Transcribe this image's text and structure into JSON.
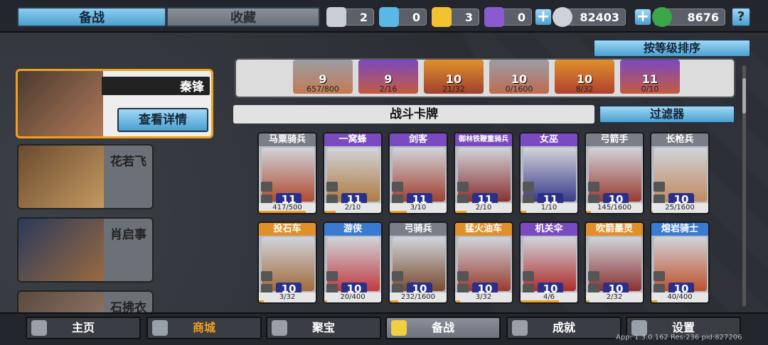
{
  "tabs": {
    "active": "备战",
    "inactive": "收藏"
  },
  "resources": [
    {
      "icon": "silver-chest-icon",
      "value": "2",
      "color": "#c8cdd6"
    },
    {
      "icon": "crystal-chest-icon",
      "value": "0",
      "color": "#59b8e6"
    },
    {
      "icon": "gold-chest-icon",
      "value": "3",
      "color": "#f2c230"
    },
    {
      "icon": "purple-chest-icon",
      "value": "0",
      "color": "#8a5ad0"
    }
  ],
  "coins": "82403",
  "gems": "8676",
  "sort_label": "按等级排序",
  "leaders": [
    {
      "name": "秦锋",
      "detail": "查看详情"
    },
    {
      "name": "花若飞"
    },
    {
      "name": "肖启事"
    },
    {
      "name": "石拂衣"
    }
  ],
  "deck": [
    {
      "level": "9",
      "count": "657/800"
    },
    {
      "level": "9",
      "count": "2/16"
    },
    {
      "level": "10",
      "count": "21/32"
    },
    {
      "level": "10",
      "count": "0/1600"
    },
    {
      "level": "10",
      "count": "8/32"
    },
    {
      "level": "11",
      "count": "0/10"
    }
  ],
  "section_title": "战斗卡牌",
  "filter_label": "过滤器",
  "cards_row1": [
    {
      "name": "马粟骑兵",
      "level": "11",
      "count": "417/500",
      "tier": "t-grey",
      "fill": 0.83
    },
    {
      "name": "一窝蜂",
      "level": "11",
      "count": "2/10",
      "tier": "t-purple",
      "fill": 0.2
    },
    {
      "name": "剑客",
      "level": "11",
      "count": "3/10",
      "tier": "t-purple",
      "fill": 0.3
    },
    {
      "name": "御林铁鞭重骑兵",
      "level": "11",
      "count": "2/10",
      "tier": "t-purple",
      "fill": 0.2
    },
    {
      "name": "女巫",
      "level": "11",
      "count": "1/10",
      "tier": "t-purple",
      "fill": 0.1
    },
    {
      "name": "弓箭手",
      "level": "10",
      "count": "145/1600",
      "tier": "t-grey",
      "fill": 0.09
    },
    {
      "name": "长枪兵",
      "level": "10",
      "count": "25/1600",
      "tier": "t-grey",
      "fill": 0.02
    }
  ],
  "cards_row2": [
    {
      "name": "投石车",
      "level": "10",
      "count": "3/32",
      "tier": "t-orange",
      "fill": 0.09
    },
    {
      "name": "游侠",
      "level": "10",
      "count": "20/400",
      "tier": "t-blue",
      "fill": 0.05
    },
    {
      "name": "弓骑兵",
      "level": "10",
      "count": "232/1600",
      "tier": "t-grey",
      "fill": 0.15
    },
    {
      "name": "猛火油车",
      "level": "10",
      "count": "3/32",
      "tier": "t-orange",
      "fill": 0.09
    },
    {
      "name": "机关伞",
      "level": "10",
      "count": "4/6",
      "tier": "t-purple",
      "fill": 0.67
    },
    {
      "name": "吹箭墨灵",
      "level": "10",
      "count": "2/32",
      "tier": "t-orange",
      "fill": 0.06
    },
    {
      "name": "熔岩骑士",
      "level": "10",
      "count": "40/400",
      "tier": "t-blue",
      "fill": 0.1
    }
  ],
  "nav": [
    {
      "label": "主页",
      "icon": "home-icon"
    },
    {
      "label": "商城",
      "icon": "shop-icon"
    },
    {
      "label": "聚宝",
      "icon": "treasure-icon"
    },
    {
      "label": "备战",
      "icon": "card-icon"
    },
    {
      "label": "成就",
      "icon": "achievement-icon"
    },
    {
      "label": "设置",
      "icon": "settings-icon"
    }
  ],
  "version": "App: 1.3.0.162 Res:236 pid:827206"
}
